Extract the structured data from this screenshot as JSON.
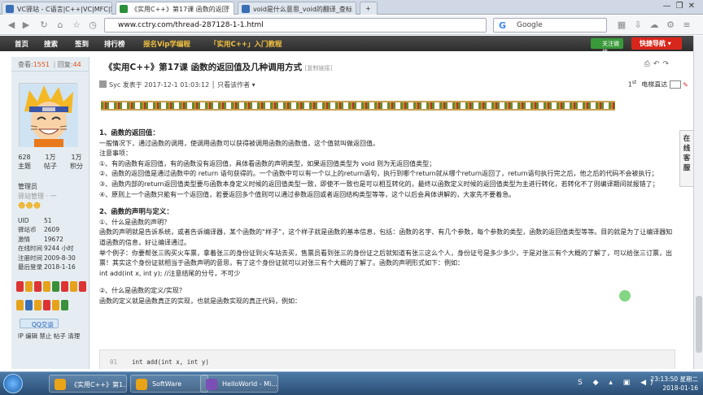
{
  "browser": {
    "tabs": [
      {
        "label": "VC驿站 - C语言|C++|VC|MFC|培训",
        "active": false,
        "favicon_color": "#3a6fb5"
      },
      {
        "label": "《实用C++》第17课 函数的返回",
        "active": true,
        "favicon_color": "#2a8f3a"
      },
      {
        "label": "void是什么意思_void的翻译_查标",
        "active": false,
        "favicon_color": "#3a6fb5"
      }
    ],
    "url": "www.cctry.com/thread-287128-1-1.html",
    "search_engine": "Google"
  },
  "site_nav": {
    "items": [
      "首页",
      "搜索",
      "签到",
      "排行榜",
      "报名Vip学编程",
      "「实用C++」入门教程"
    ],
    "follow_label": "关注微信",
    "quick_label": "快捷导航"
  },
  "sidebar": {
    "views_label": "查看:",
    "views_count": "1551",
    "replies_label": "回复:",
    "replies_count": "44",
    "stats": [
      {
        "value": "628",
        "label": "主题"
      },
      {
        "value": "1万",
        "label": "帖子"
      },
      {
        "value": "1万",
        "label": "积分"
      }
    ],
    "role": "管理员",
    "role_sub": "驿站管理 · 一",
    "profile": [
      {
        "key": "UID",
        "value": "51"
      },
      {
        "key": "驿站币",
        "value": "2609"
      },
      {
        "key": "激情",
        "value": "19672"
      },
      {
        "key": "在线时间",
        "value": "9244 小时"
      },
      {
        "key": "注册时间",
        "value": "2009-8-30"
      },
      {
        "key": "最后登录",
        "value": "2018-1-16"
      }
    ],
    "qq_label": "QQ交谈",
    "tools": "IP 编辑 禁止 帖子 清理"
  },
  "post": {
    "title": "《实用C++》第17课 函数的返回值及几种调用方式",
    "copy_link": "[复制链接]",
    "meta": "Syc 发表于 2017-12-1 01:03:12 │ 只看该作者 ▾",
    "floor": "1",
    "floor_sup": "st",
    "tv_label": "电梯直达",
    "sidetab": "在线客服",
    "body": [
      {
        "type": "h",
        "text": "1、函数的返回值："
      },
      {
        "type": "p",
        "text": "一般情况下，通过函数的调用，使调用函数可以获得被调用函数的函数值，这个值就叫做返回值。"
      },
      {
        "type": "p",
        "text": "注意事项："
      },
      {
        "type": "p",
        "text": "①、有的函数有返回值，有的函数没有返回值，具体看函数的声明类型，如果返回值类型为 void 则为无返回值类型；"
      },
      {
        "type": "p",
        "text": "②、函数的返回值是通过函数中的 return 语句获得的。一个函数中可以有一个以上的return语句，执行到哪个return就从哪个return返回了，return语句执行完之后，他之后的代码不会被执行；"
      },
      {
        "type": "p",
        "text": "③、函数内部的return返回值类型要与函数本身定义时候的返回值类型一致，即使不一致也是可以相互转化的，最终以函数定义时候的返回值类型为主进行转化，若转化不了则编译期间就报错了；"
      },
      {
        "type": "p",
        "text": "④、原则上一个函数只能有一个返回值，若要返回多个值则可以通过参数返回或者返回结构类型等等，这个以后会具体讲解的，大家先不要着急。"
      },
      {
        "type": "sp",
        "text": ""
      },
      {
        "type": "h",
        "text": "2、函数的声明与定义："
      },
      {
        "type": "p",
        "text": "①、什么是函数的声明？"
      },
      {
        "type": "p",
        "text": "函数的声明就是告诉系统，或者告诉编译器，某个函数的“样子”，这个样子就是函数的基本信息，包括：函数的名字、有几个参数，每个参数的类型，函数的返回值类型等等。目的就是为了让编译器知道函数的信息，好让编译通过。"
      },
      {
        "type": "p",
        "text": "举个例子：你要帮张三购买火车票，拿着张三的身份证到火车站去买，售票员看到张三的身份证之后就知道有张三这么个人，身份证号是多少多少，于是对张三有个大概的了解了，可以给张三订票，出票！其实这个身份证就相当于函数声明的意思，有了这个身份证就可以对张三有个大概的了解了。函数的声明形式如下：例如："
      },
      {
        "type": "p",
        "text": "int add(int x, int y); //注意结尾的分号，不可少"
      },
      {
        "type": "sp",
        "text": ""
      },
      {
        "type": "p",
        "text": "②、什么是函数的定义/实现？"
      },
      {
        "type": "p",
        "text": "函数的定义就是函数真正的实现，也就是函数实现的真正代码，例如："
      }
    ],
    "code_line_no": "01",
    "code_line": "int add(int x, int y)"
  },
  "taskbar": {
    "items": [
      {
        "label": "《实用C++》第1...",
        "icon_color": "#e8a317"
      },
      {
        "label": "SoftWare",
        "icon_color": "#e8a317"
      },
      {
        "label": "HelloWorld - Mi...",
        "icon_color": "#7b4fb5"
      }
    ],
    "time": "23:13:50 星期二",
    "date": "2018-01-16",
    "tray_icons": "S ◆ ▴ ▣ ◀)"
  },
  "colors": {
    "site_nav_bg": "#3a3a3a",
    "accent_red": "#d9261c",
    "accent_gold": "#f0c040",
    "sidebar_bg": "#e5edf2"
  }
}
